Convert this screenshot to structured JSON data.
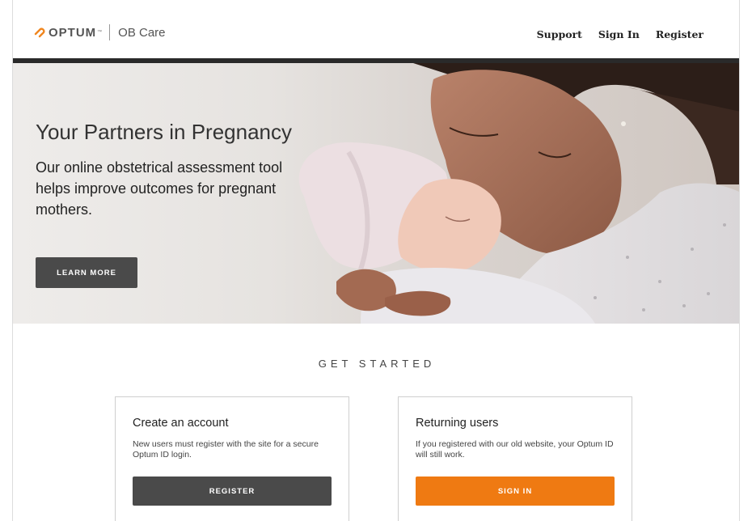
{
  "brand": {
    "logo_text": "OPTUM",
    "trademark": "™",
    "product": "OB Care",
    "accent_color": "#f0861f"
  },
  "nav": {
    "support": "Support",
    "sign_in": "Sign In",
    "register": "Register"
  },
  "hero": {
    "title": "Your Partners in Pregnancy",
    "text": "Our online obstetrical assessment tool helps improve outcomes for pregnant mothers.",
    "button": "LEARN MORE",
    "image": "mother-kissing-newborn-photo"
  },
  "get_started": {
    "heading": "GET STARTED",
    "create": {
      "title": "Create an account",
      "text": "New users must register with the site for a secure Optum ID login.",
      "button": "REGISTER",
      "button_color": "#4a4a4a"
    },
    "returning": {
      "title": "Returning users",
      "text": "If you registered with our old website, your Optum ID will still work.",
      "button": "SIGN IN",
      "button_color": "#ef7a12"
    }
  }
}
